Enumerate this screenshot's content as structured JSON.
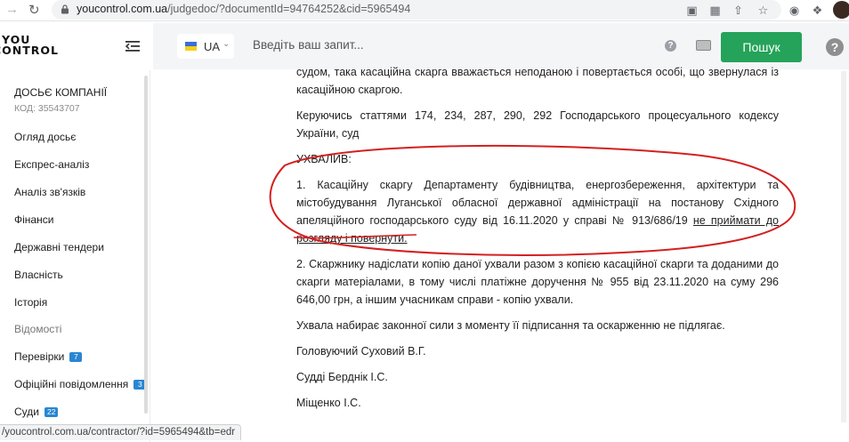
{
  "browser": {
    "url_host": "youcontrol.com.ua",
    "url_path": "/judgedoc/?documentId=94764252&cid=5965494"
  },
  "header": {
    "logo_line1": "YOU",
    "logo_line2": "CONTROL",
    "lang_code": "UA",
    "search_placeholder": "Введіть ваш запит...",
    "search_button": "Пошук",
    "help_small": "?",
    "help_big": "?"
  },
  "sidebar": {
    "company_title": "ДОСЬЄ КОМПАНІЇ",
    "company_code": "КОД: 35543707",
    "items": [
      {
        "label": "Огляд досьє"
      },
      {
        "label": "Експрес-аналіз"
      },
      {
        "label": "Аналіз зв'язків"
      },
      {
        "label": "Фінанси"
      },
      {
        "label": "Державні тендери"
      },
      {
        "label": "Власність"
      },
      {
        "label": "Історія"
      },
      {
        "label": "Відомості"
      },
      {
        "label": "Перевірки",
        "badge": "7"
      },
      {
        "label": "Офіційні повідомлення",
        "badge": "3"
      },
      {
        "label": "Суди",
        "badge": "22"
      }
    ]
  },
  "document": {
    "p0": "судом, така касаційна скарга вважається неподаною і повертається особі, що звернулася із касаційною скаргою.",
    "p1": "Керуючись статтями 174, 234, 287, 290, 292 Господарського процесуального кодексу України, суд",
    "p2": "УХВАЛИВ:",
    "p3_main": "1. Касаційну скаргу Департаменту будівництва, енергозбереження, архітектури та містобудування Луганської обласної державної адміністрації на постанову Східного апеляційного господарського суду від 16.11.2020 у справі № 913/686/19 ",
    "p3_underlined": "не приймати до розгляду і повернути.",
    "p4": "2. Скаржнику надіслати копію даної ухвали разом з копією касаційної скарги та доданими до скарги матеріалами, в тому числі платіжне доручення № 955 від 23.11.2020 на суму 296 646,00 грн, а іншим учасникам справи - копію ухвали.",
    "p5": "Ухвала набирає законної сили з моменту її підписання та оскарженню не підлягає.",
    "p6": "Головуючий Суховий В.Г.",
    "p7": "Судді Берднік І.С.",
    "p8": "Міщенко І.С."
  },
  "statusbar": {
    "link": "/youcontrol.com.ua/contractor/?id=5965494&tb=edr"
  },
  "colors": {
    "search_button": "#25a35a",
    "badge": "#2a86d1",
    "annotation": "#d42020"
  }
}
